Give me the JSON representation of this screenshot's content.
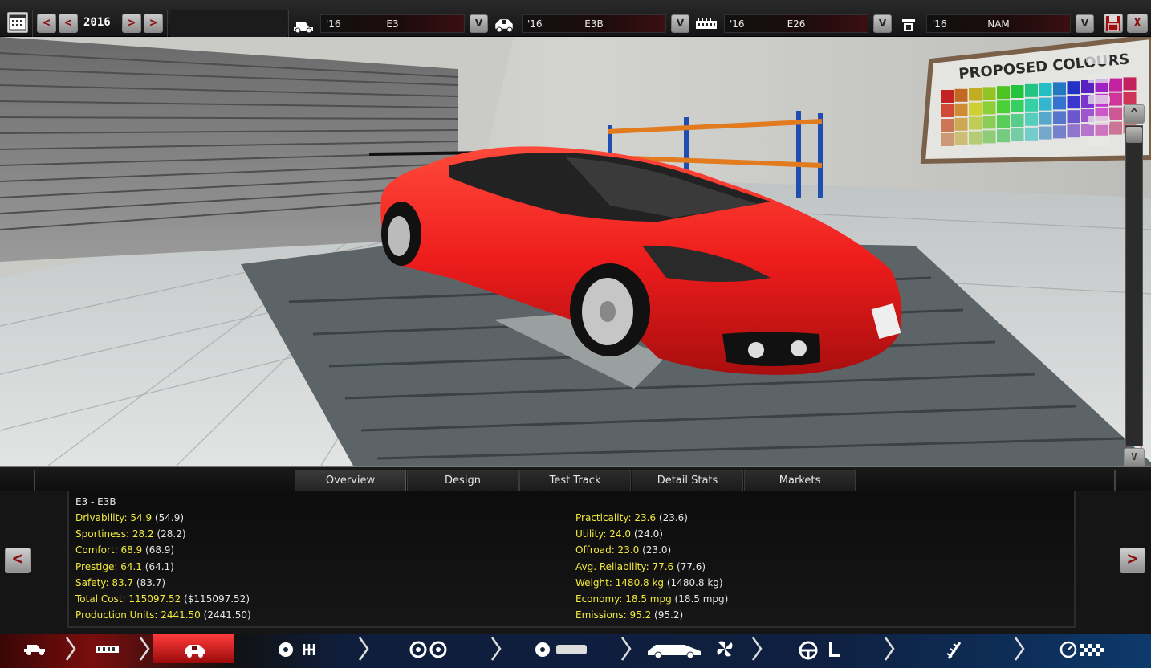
{
  "topbar": {
    "year": "2016",
    "prev_labels": [
      "<",
      "<"
    ],
    "next_labels": [
      ">",
      ">"
    ],
    "selectors": [
      {
        "prefix": "'16",
        "value": "E3",
        "dropdown": "V"
      },
      {
        "prefix": "'16",
        "value": "E3B",
        "dropdown": "V"
      },
      {
        "prefix": "'16",
        "value": "E26",
        "dropdown": "V"
      },
      {
        "prefix": "'16",
        "value": "NAM",
        "dropdown": "V"
      }
    ],
    "close_label": "X"
  },
  "scene": {
    "poster_text": "PROPOSED COLOURS",
    "scroll_up": "^",
    "scroll_down": "V"
  },
  "tabs": [
    "Overview",
    "Design",
    "Test Track",
    "Detail Stats",
    "Markets"
  ],
  "stats": {
    "model": "E3 - E3B",
    "left": [
      {
        "label": "Drivability: 54.9",
        "prev": "(54.9)"
      },
      {
        "label": "Sportiness: 28.2",
        "prev": "(28.2)"
      },
      {
        "label": "Comfort: 68.9",
        "prev": "(68.9)"
      },
      {
        "label": "Prestige: 64.1",
        "prev": "(64.1)"
      },
      {
        "label": "Safety: 83.7",
        "prev": "(83.7)"
      },
      {
        "label": "Total Cost: 115097.52",
        "prev": "($115097.52)"
      },
      {
        "label": "Production Units: 2441.50",
        "prev": "(2441.50)"
      }
    ],
    "right": [
      {
        "label": "Practicality: 23.6",
        "prev": "(23.6)"
      },
      {
        "label": "Utility: 24.0",
        "prev": "(24.0)"
      },
      {
        "label": "Offroad: 23.0",
        "prev": "(23.0)"
      },
      {
        "label": "Avg. Reliability: 77.6",
        "prev": "(77.6)"
      },
      {
        "label": "Weight: 1480.8 kg",
        "prev": "(1480.8 kg)"
      },
      {
        "label": "Economy: 18.5 mpg",
        "prev": "(18.5 mpg)"
      },
      {
        "label": "Emissions: 95.2",
        "prev": "(95.2)"
      }
    ]
  },
  "nav": {
    "prev": "<",
    "next": ">"
  },
  "colors": {
    "accent_red": "#c01818",
    "stat_yellow": "#f2ea3c",
    "car_red": "#ee1c1c"
  }
}
